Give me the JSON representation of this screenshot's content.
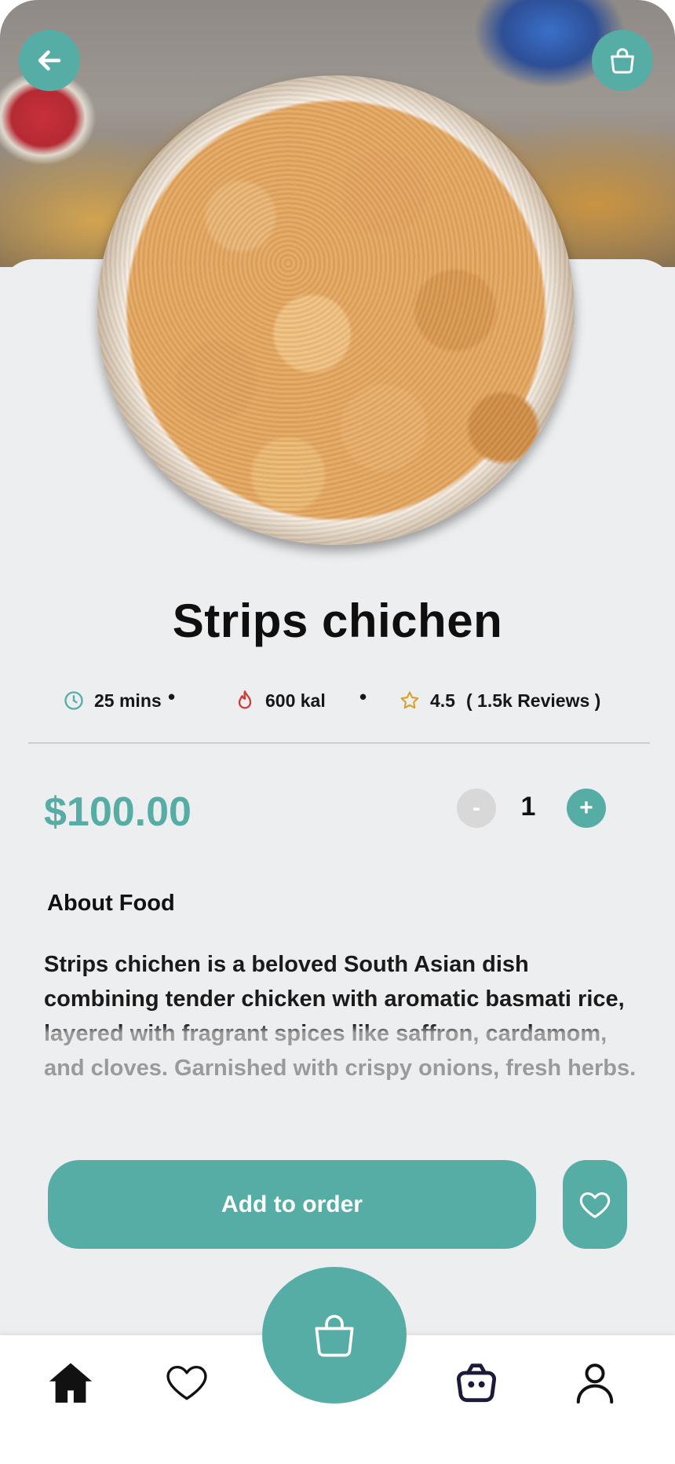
{
  "header": {
    "back_icon": "arrow-left-icon",
    "cart_icon": "shopping-bag-icon"
  },
  "product": {
    "title": "Strips chichen",
    "time": "25 mins",
    "calories": "600 kal",
    "rating": "4.5",
    "reviews": "( 1.5k Reviews )",
    "price": "$100.00",
    "quantity": "1",
    "minus_label": "-",
    "plus_label": "+"
  },
  "about": {
    "heading": "About Food",
    "text": "Strips chichen is a beloved South Asian dish combining tender chicken with aromatic basmati rice, layered with fragrant spices like saffron, cardamom, and cloves. Garnished with crispy onions, fresh herbs."
  },
  "actions": {
    "add_label": "Add to order",
    "favorite_icon": "heart-icon"
  },
  "nav": {
    "items": [
      "home-icon",
      "heart-icon",
      "shopping-bag-icon",
      "bag-icon",
      "user-icon"
    ]
  },
  "colors": {
    "accent": "#56ada6",
    "background": "#edeef0",
    "fire": "#d23a3a",
    "star": "#d9a128"
  }
}
